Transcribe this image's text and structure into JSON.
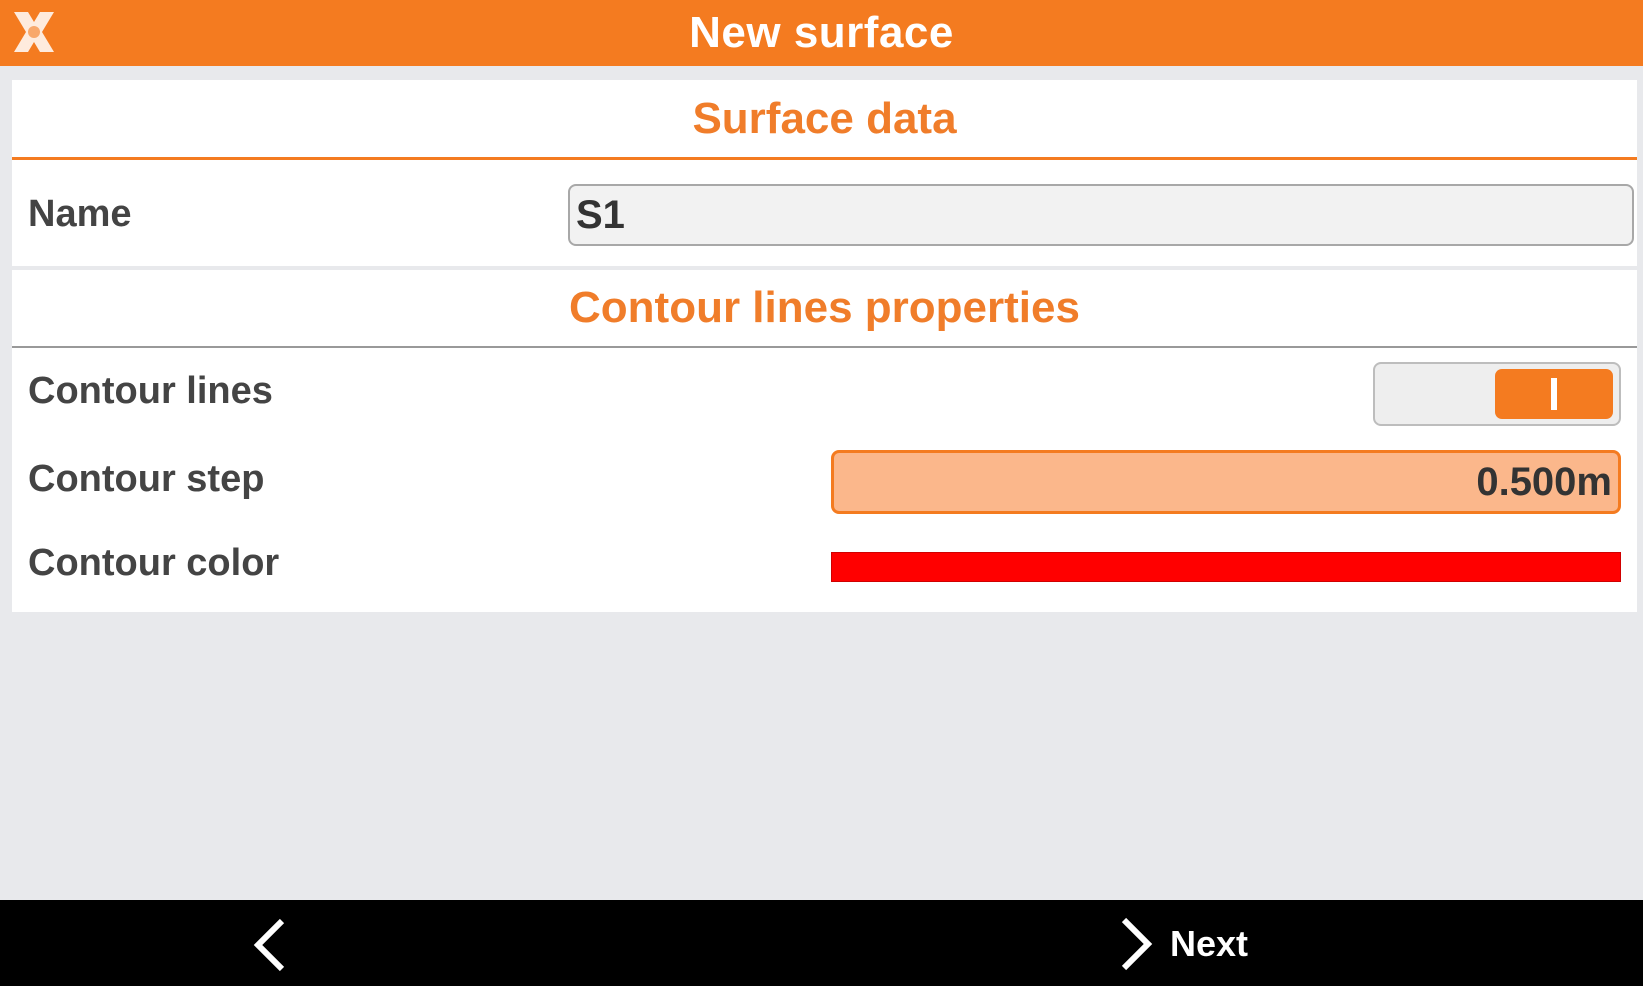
{
  "app": {
    "title": "New surface"
  },
  "surface_data": {
    "header": "Surface data",
    "name_label": "Name",
    "name_value": "S1"
  },
  "contour": {
    "header": "Contour lines properties",
    "lines_label": "Contour lines",
    "lines_enabled": true,
    "step_label": "Contour step",
    "step_value": "0.500m",
    "color_label": "Contour color",
    "color_value": "#ff0000"
  },
  "footer": {
    "back_icon": "chevron-left-icon",
    "next_icon": "chevron-right-icon",
    "next_label": "Next"
  },
  "colors": {
    "accent": "#f47b20",
    "background": "#e8e9ec",
    "footer": "#000000"
  }
}
